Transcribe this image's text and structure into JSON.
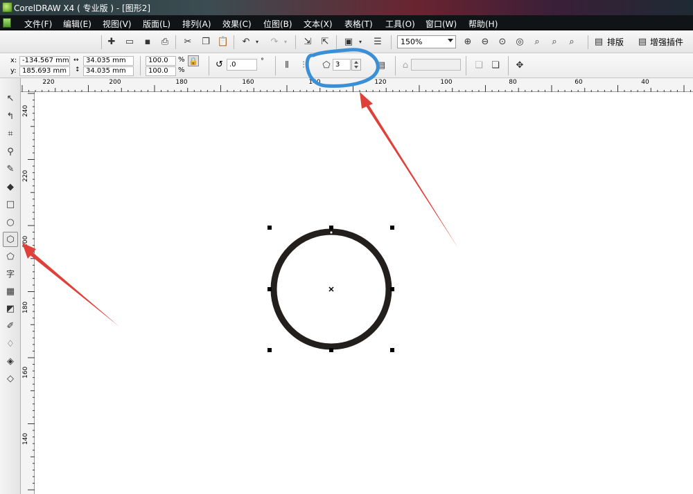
{
  "window": {
    "title": "CorelDRAW X4 ( 专业版 ) - [图形2]"
  },
  "menu": [
    "文件(F)",
    "编辑(E)",
    "视图(V)",
    "版面(L)",
    "排列(A)",
    "效果(C)",
    "位图(B)",
    "文本(X)",
    "表格(T)",
    "工具(O)",
    "窗口(W)",
    "帮助(H)"
  ],
  "toolbar": {
    "zoom": "150%",
    "layout_label": "排版",
    "plugin_label": "增强插件"
  },
  "property_bar": {
    "x_label": "x:",
    "x_value": "-134.567 mm",
    "y_label": "y:",
    "y_value": "185.693 mm",
    "width": "34.035 mm",
    "height": "34.035 mm",
    "scale_w": "100.0",
    "scale_h": "100.0",
    "percent": "%",
    "rotation": ".0",
    "degree": "°",
    "polygon_sides": "3"
  },
  "ruler": {
    "h_ticks": [
      "220",
      "200",
      "180",
      "160",
      "140",
      "120",
      "100",
      "80",
      "60",
      "40"
    ],
    "v_ticks": [
      "240",
      "220",
      "200",
      "180",
      "160",
      "140"
    ]
  },
  "colors": {
    "highlight": "#3b8fd6",
    "arrow": "#e0403a",
    "shape_stroke": "#231f1d"
  }
}
